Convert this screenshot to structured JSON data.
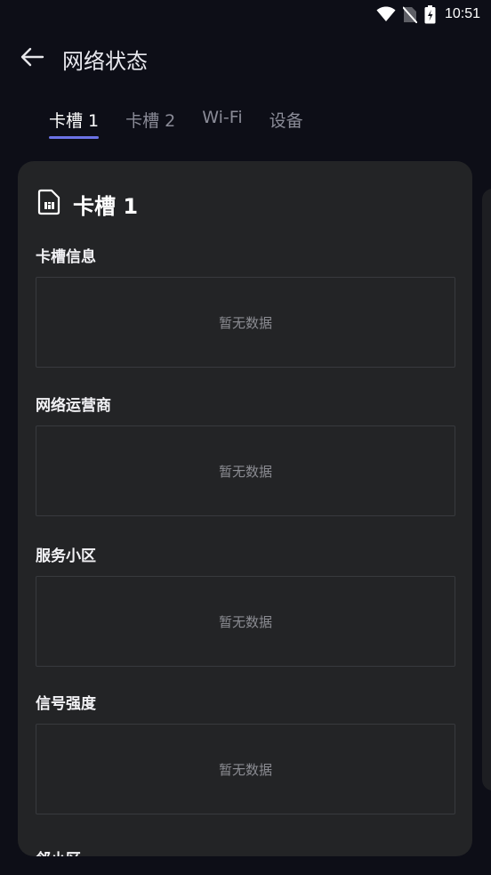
{
  "status_bar": {
    "time": "10:51",
    "icons": [
      "wifi-icon",
      "no-sim-icon",
      "battery-charging-icon"
    ]
  },
  "app_bar": {
    "back_icon": "arrow-left-icon",
    "title": "网络状态"
  },
  "tabs": [
    {
      "label": "卡槽 1",
      "active": true
    },
    {
      "label": "卡槽 2",
      "active": false
    },
    {
      "label": "Wi-Fi",
      "active": false
    },
    {
      "label": "设备",
      "active": false
    }
  ],
  "card": {
    "icon": "sim-card-icon",
    "title": "卡槽 1",
    "sections": [
      {
        "label": "卡槽信息",
        "empty_text": "暂无数据"
      },
      {
        "label": "网络运营商",
        "empty_text": "暂无数据"
      },
      {
        "label": "服务小区",
        "empty_text": "暂无数据"
      },
      {
        "label": "信号强度",
        "empty_text": "暂无数据"
      }
    ],
    "next_section_label": "邻小区"
  },
  "colors": {
    "background": "#0d0e17",
    "card": "#232426",
    "tab_indicator": "#6c73e6"
  }
}
